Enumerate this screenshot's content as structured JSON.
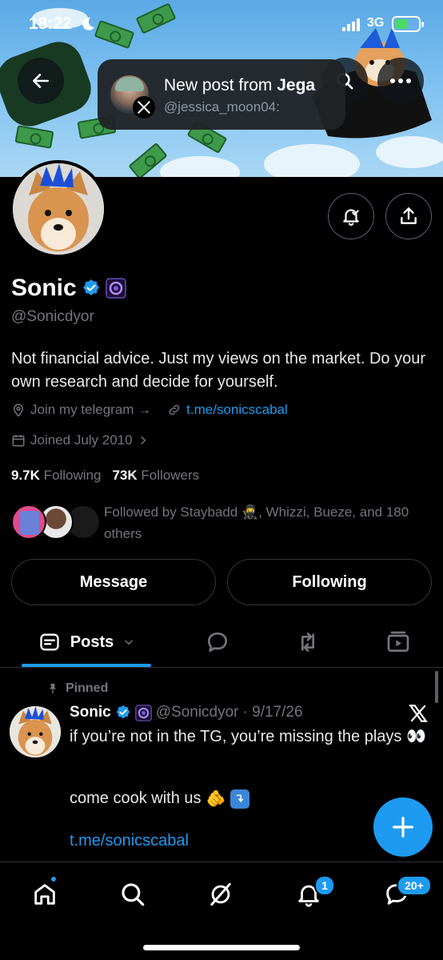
{
  "status_bar": {
    "time": "18:22",
    "network": "3G"
  },
  "toast": {
    "title_prefix": "New post from ",
    "title_name": "Jega",
    "subtitle": "@jessica_moon04:"
  },
  "profile": {
    "name": "Sonic",
    "handle": "@Sonicdyor",
    "bio": "Not financial advice. Just my views on the market. Do your own research and decide for yourself.",
    "location": "Join my telegram →",
    "website": "t.me/sonicscabal",
    "joined": "Joined July 2010",
    "following_count": "9.7K",
    "following_label": "Following",
    "followers_count": "73K",
    "followers_label": "Followers",
    "followed_by": "Followed by Staybadd 🥷, Whizzi, Bueze, and 180 others"
  },
  "actions": {
    "message": "Message",
    "following": "Following"
  },
  "tabs": {
    "posts": "Posts"
  },
  "post": {
    "pinned_label": "Pinned",
    "author": "Sonic",
    "handle": "@Sonicdyor",
    "date": "· 9/17/26",
    "text_line1": "if you’re not in the TG, you’re missing the plays 👀",
    "text_line2": "come cook with us",
    "link": "t.me/sonicscabal"
  },
  "bottom_nav": {
    "notifications_badge": "1",
    "messages_badge": "20+"
  },
  "colors": {
    "accent": "#1d9bf0",
    "background": "#000000",
    "muted": "#71767b"
  }
}
